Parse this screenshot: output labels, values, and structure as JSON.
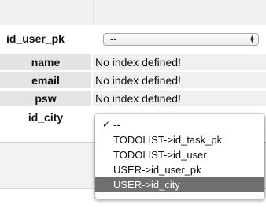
{
  "field_header": {
    "label": "id_user_pk",
    "select_value": "--"
  },
  "rows": [
    {
      "label": "name",
      "value": "No index defined!"
    },
    {
      "label": "email",
      "value": "No index defined!"
    },
    {
      "label": "psw",
      "value": "No index defined!"
    }
  ],
  "city_row": {
    "label": "id_city"
  },
  "dropdown": {
    "checkmark": "✓",
    "options": [
      "--",
      "TODOLIST->id_task_pk",
      "TODOLIST->id_user",
      "USER->id_user_pk",
      "USER->id_city"
    ],
    "checked_index": 0,
    "highlighted_index": 4
  },
  "icons": {
    "stepper": "select-stepper-icon",
    "check": "checkmark-icon"
  }
}
